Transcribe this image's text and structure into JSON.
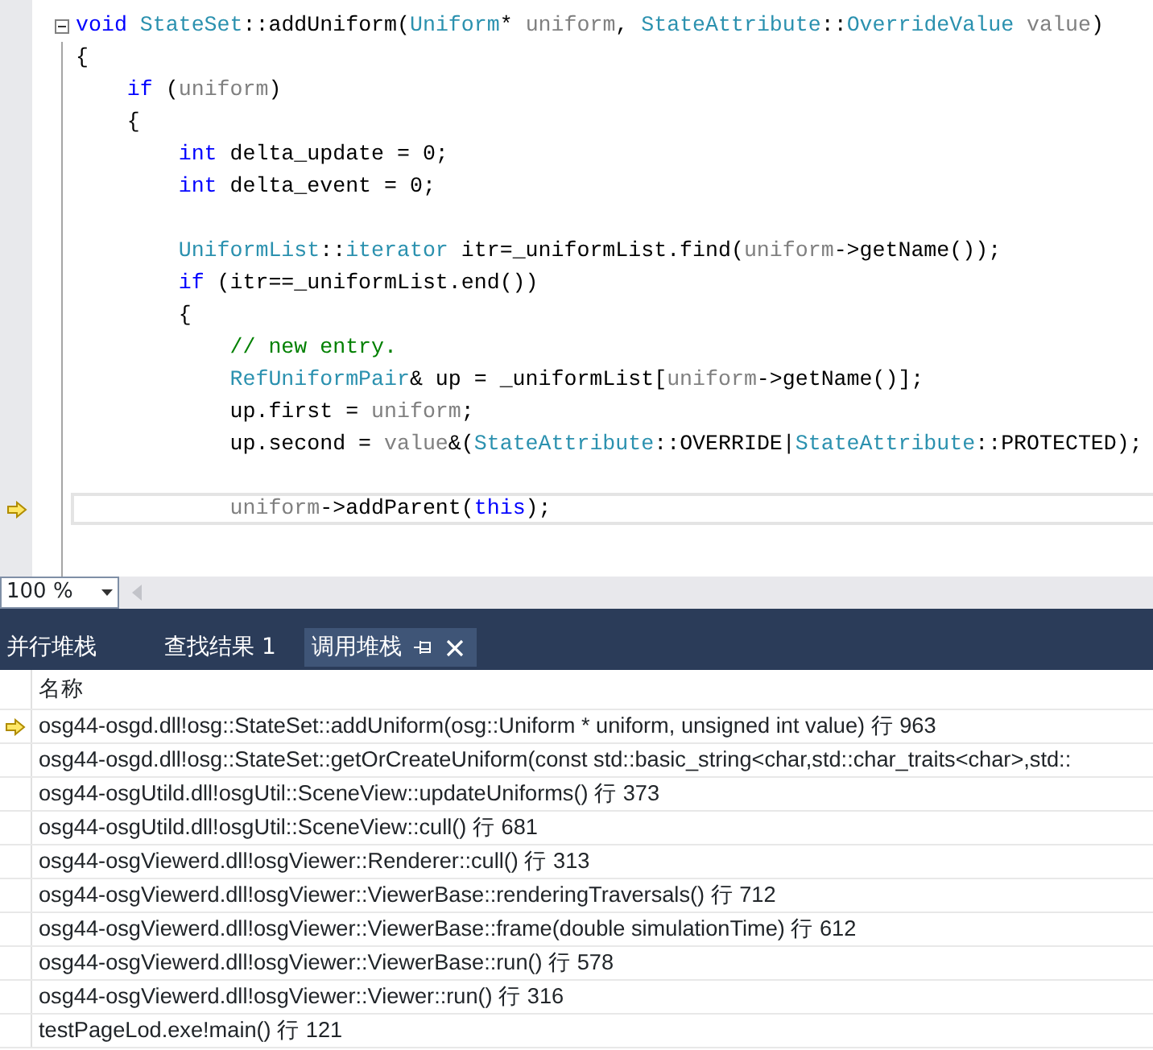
{
  "editor": {
    "lines": [
      {
        "collapsible": true,
        "tokens": [
          {
            "kind": "keyword",
            "text": "void"
          },
          {
            "kind": "type",
            "text": " StateSet"
          },
          {
            "kind": "plain",
            "text": "::addUniform("
          },
          {
            "kind": "type",
            "text": "Uniform"
          },
          {
            "kind": "plain",
            "text": "* "
          },
          {
            "kind": "param",
            "text": "uniform"
          },
          {
            "kind": "plain",
            "text": ", "
          },
          {
            "kind": "type",
            "text": "StateAttribute"
          },
          {
            "kind": "plain",
            "text": "::"
          },
          {
            "kind": "type",
            "text": "OverrideValue"
          },
          {
            "kind": "param",
            "text": " value"
          },
          {
            "kind": "plain",
            "text": ")"
          }
        ]
      },
      {
        "tokens": [
          {
            "kind": "plain",
            "text": "{"
          }
        ]
      },
      {
        "tokens": [
          {
            "kind": "keyword",
            "text": "    if"
          },
          {
            "kind": "plain",
            "text": " ("
          },
          {
            "kind": "param",
            "text": "uniform"
          },
          {
            "kind": "plain",
            "text": ")"
          }
        ]
      },
      {
        "tokens": [
          {
            "kind": "plain",
            "text": "    {"
          }
        ]
      },
      {
        "tokens": [
          {
            "kind": "keyword",
            "text": "        int"
          },
          {
            "kind": "plain",
            "text": " delta_update = 0;"
          }
        ]
      },
      {
        "space_after": true,
        "tokens": [
          {
            "kind": "keyword",
            "text": "        int"
          },
          {
            "kind": "plain",
            "text": " delta_event = 0;"
          }
        ]
      },
      {
        "tokens": [
          {
            "kind": "type",
            "text": "        UniformList"
          },
          {
            "kind": "plain",
            "text": "::"
          },
          {
            "kind": "type",
            "text": "iterator"
          },
          {
            "kind": "plain",
            "text": " itr=_uniformList.find("
          },
          {
            "kind": "param",
            "text": "uniform"
          },
          {
            "kind": "plain",
            "text": "->getName());"
          }
        ]
      },
      {
        "tokens": [
          {
            "kind": "keyword",
            "text": "        if"
          },
          {
            "kind": "plain",
            "text": " (itr==_uniformList.end())"
          }
        ]
      },
      {
        "tokens": [
          {
            "kind": "plain",
            "text": "        {"
          }
        ]
      },
      {
        "tokens": [
          {
            "kind": "comment",
            "text": "            // new entry."
          }
        ]
      },
      {
        "tokens": [
          {
            "kind": "type",
            "text": "            RefUniformPair"
          },
          {
            "kind": "plain",
            "text": "& up = _uniformList["
          },
          {
            "kind": "param",
            "text": "uniform"
          },
          {
            "kind": "plain",
            "text": "->getName()];"
          }
        ]
      },
      {
        "tokens": [
          {
            "kind": "plain",
            "text": "            up.first = "
          },
          {
            "kind": "param",
            "text": "uniform"
          },
          {
            "kind": "plain",
            "text": ";"
          }
        ]
      },
      {
        "space_after": true,
        "tokens": [
          {
            "kind": "plain",
            "text": "            up.second = "
          },
          {
            "kind": "param",
            "text": "value"
          },
          {
            "kind": "plain",
            "text": "&("
          },
          {
            "kind": "type",
            "text": "StateAttribute"
          },
          {
            "kind": "plain",
            "text": "::OVERRIDE|"
          },
          {
            "kind": "type",
            "text": "StateAttribute"
          },
          {
            "kind": "plain",
            "text": "::PROTECTED);"
          }
        ]
      },
      {
        "current": true,
        "tokens": [
          {
            "kind": "param",
            "text": "            uniform"
          },
          {
            "kind": "plain",
            "text": "->addParent("
          },
          {
            "kind": "keyword",
            "text": "this"
          },
          {
            "kind": "plain",
            "text": ");"
          }
        ]
      }
    ]
  },
  "zoom": {
    "value": "100 %"
  },
  "tabs": [
    {
      "label": "并行堆栈",
      "selected": false,
      "pinnable": false
    },
    {
      "label": "查找结果 1",
      "selected": false,
      "pinnable": false
    },
    {
      "label": "调用堆栈",
      "selected": true,
      "pinnable": true
    }
  ],
  "call_stack": {
    "columns": [
      "名称"
    ],
    "rows": [
      {
        "text": "osg44-osgd.dll!osg::StateSet::addUniform(osg::Uniform * uniform, unsigned int value) 行 963",
        "current": true
      },
      {
        "text": "osg44-osgd.dll!osg::StateSet::getOrCreateUniform(const std::basic_string<char,std::char_traits<char>,std::",
        "current": false
      },
      {
        "text": "osg44-osgUtild.dll!osgUtil::SceneView::updateUniforms() 行 373",
        "current": false
      },
      {
        "text": "osg44-osgUtild.dll!osgUtil::SceneView::cull() 行 681",
        "current": false
      },
      {
        "text": "osg44-osgViewerd.dll!osgViewer::Renderer::cull() 行 313",
        "current": false
      },
      {
        "text": "osg44-osgViewerd.dll!osgViewer::ViewerBase::renderingTraversals() 行 712",
        "current": false
      },
      {
        "text": "osg44-osgViewerd.dll!osgViewer::ViewerBase::frame(double simulationTime) 行 612",
        "current": false
      },
      {
        "text": "osg44-osgViewerd.dll!osgViewer::ViewerBase::run() 行 578",
        "current": false
      },
      {
        "text": "osg44-osgViewerd.dll!osgViewer::Viewer::run() 行 316",
        "current": false
      },
      {
        "text": "testPageLod.exe!main() 行 121",
        "current": false
      }
    ]
  }
}
